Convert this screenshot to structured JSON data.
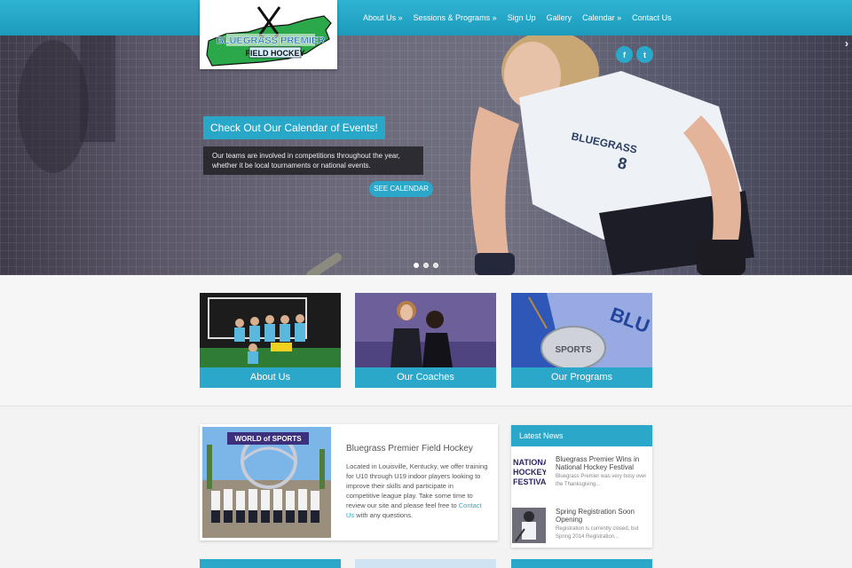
{
  "logo": {
    "line1": "BLUEGRASS PREMIER",
    "line2": "FIELD HOCKEY"
  },
  "nav": {
    "items": [
      {
        "label": "About Us »"
      },
      {
        "label": "Sessions & Programs »"
      },
      {
        "label": "Sign Up"
      },
      {
        "label": "Gallery"
      },
      {
        "label": "Calendar »"
      },
      {
        "label": "Contact Us"
      }
    ]
  },
  "hero": {
    "jersey_text": "BLUEGRASS",
    "jersey_number": "8",
    "title": "Check Out Our Calendar of Events!",
    "text": "Our teams are involved in competitions throughout the year, whether it be local tournaments or national events.",
    "button": "SEE CALENDAR",
    "social": {
      "facebook": "f",
      "twitter": "t"
    },
    "active_slide": 1,
    "slide_count": 3
  },
  "tiles": [
    {
      "label": "About Us"
    },
    {
      "label": "Our Coaches"
    },
    {
      "label": "Our Programs"
    }
  ],
  "about": {
    "title": "Bluegrass Premier Field Hockey",
    "text_before_link": "Located in Louisville, Kentucky, we offer training for U10 through U19 indoor players looking to improve their skills and participate in competitive league play. Take some time to review our site and please feel free to ",
    "link": "Contact Us",
    "text_after_link": " with any questions.",
    "photo_sign": "WORLD of SPORTS"
  },
  "news": {
    "header": "Latest News",
    "items": [
      {
        "title": "Bluegrass Premier Wins in National Hockey Festival",
        "excerpt": "Bluegrass Premier was very busy over the Thanksgiving...",
        "thumb_text": [
          "NATIONAL",
          "HOCKEY",
          "FESTIVAL"
        ]
      },
      {
        "title": "Spring Registration Soon Opening",
        "excerpt": "Registration is currently closed, but Spring 2014 Registration..."
      }
    ]
  },
  "colors": {
    "accent": "#2aa7c9",
    "nav_bar": "#22a3c5",
    "logo_green": "#2aa84a"
  }
}
